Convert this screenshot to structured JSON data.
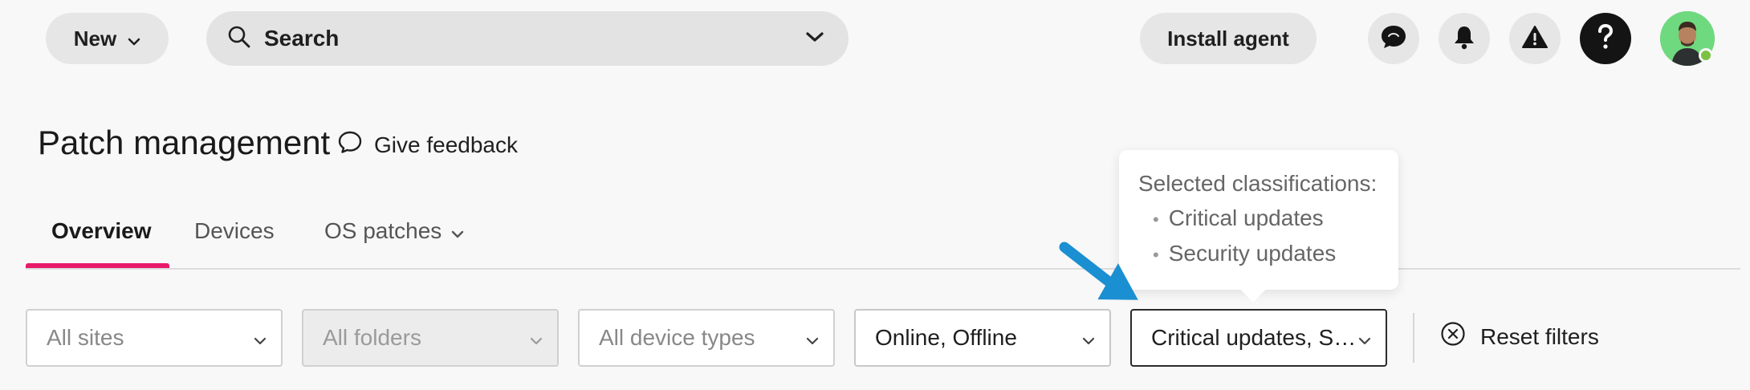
{
  "topbar": {
    "new_label": "New",
    "search_label": "Search",
    "install_label": "Install agent",
    "icons": [
      "chat-icon",
      "bell-icon",
      "warning-icon",
      "help-icon"
    ]
  },
  "header": {
    "title": "Patch management",
    "feedback_label": "Give feedback"
  },
  "tabs": [
    {
      "label": "Overview",
      "active": true
    },
    {
      "label": "Devices",
      "active": false
    },
    {
      "label": "OS patches",
      "active": false
    }
  ],
  "filters": {
    "sites": "All sites",
    "folders": "All folders",
    "device_types": "All device types",
    "status": "Online, Offline",
    "classifications": "Critical updates, Security updates",
    "reset_label": "Reset filters"
  },
  "tooltip": {
    "title": "Selected classifications:",
    "items": [
      "Critical updates",
      "Security updates"
    ]
  },
  "colors": {
    "accent": "#e8196b",
    "annotation_arrow": "#1a8fd1",
    "online_status": "#7cc242"
  }
}
